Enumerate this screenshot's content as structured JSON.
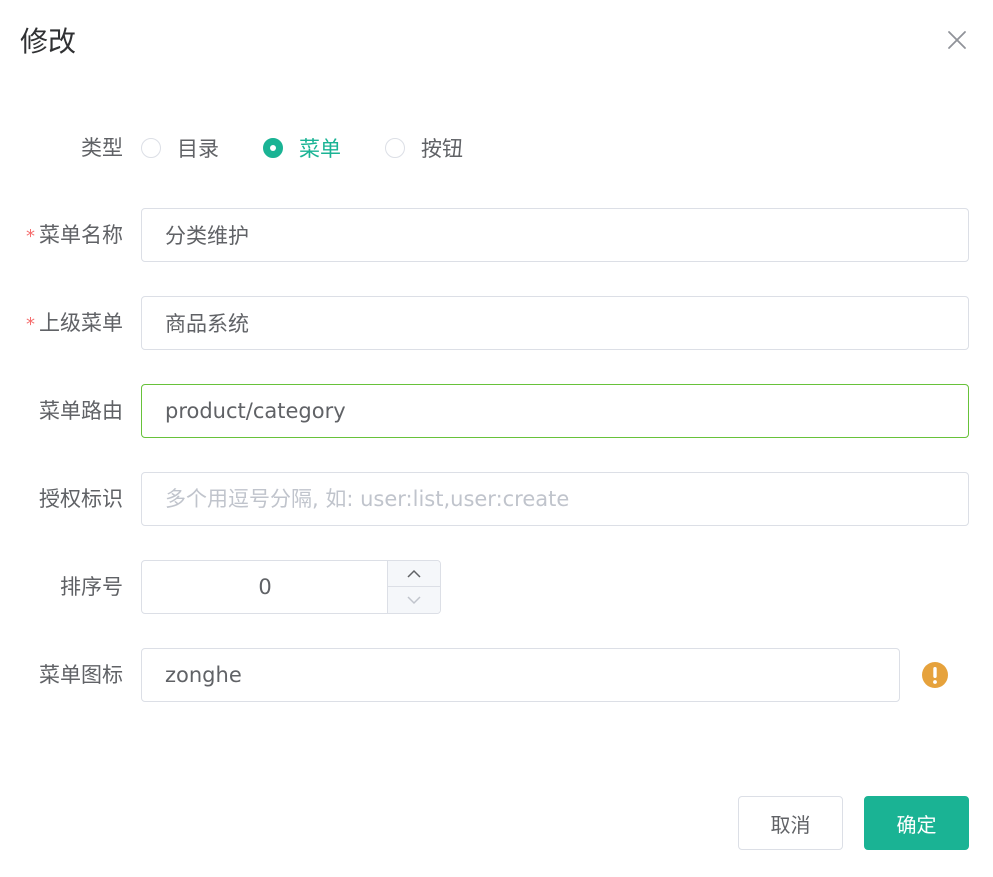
{
  "dialog": {
    "title": "修改",
    "close_icon": "close-icon"
  },
  "form": {
    "type": {
      "label": "类型",
      "options": [
        {
          "label": "目录",
          "checked": false
        },
        {
          "label": "菜单",
          "checked": true
        },
        {
          "label": "按钮",
          "checked": false
        }
      ]
    },
    "menu_name": {
      "label": "菜单名称",
      "required_mark": "*",
      "value": "分类维护"
    },
    "parent_menu": {
      "label": "上级菜单",
      "required_mark": "*",
      "value": "商品系统"
    },
    "menu_route": {
      "label": "菜单路由",
      "value": "product/category"
    },
    "permission": {
      "label": "授权标识",
      "value": "",
      "placeholder": "多个用逗号分隔, 如: user:list,user:create"
    },
    "sort_order": {
      "label": "排序号",
      "value": "0"
    },
    "menu_icon": {
      "label": "菜单图标",
      "value": "zonghe",
      "status_icon": "warning-icon"
    }
  },
  "footer": {
    "cancel_label": "取消",
    "confirm_label": "确定"
  },
  "colors": {
    "primary": "#1ab394",
    "required": "#f56c6c",
    "focus_border": "#67c23a",
    "warning": "#e6a23c"
  }
}
